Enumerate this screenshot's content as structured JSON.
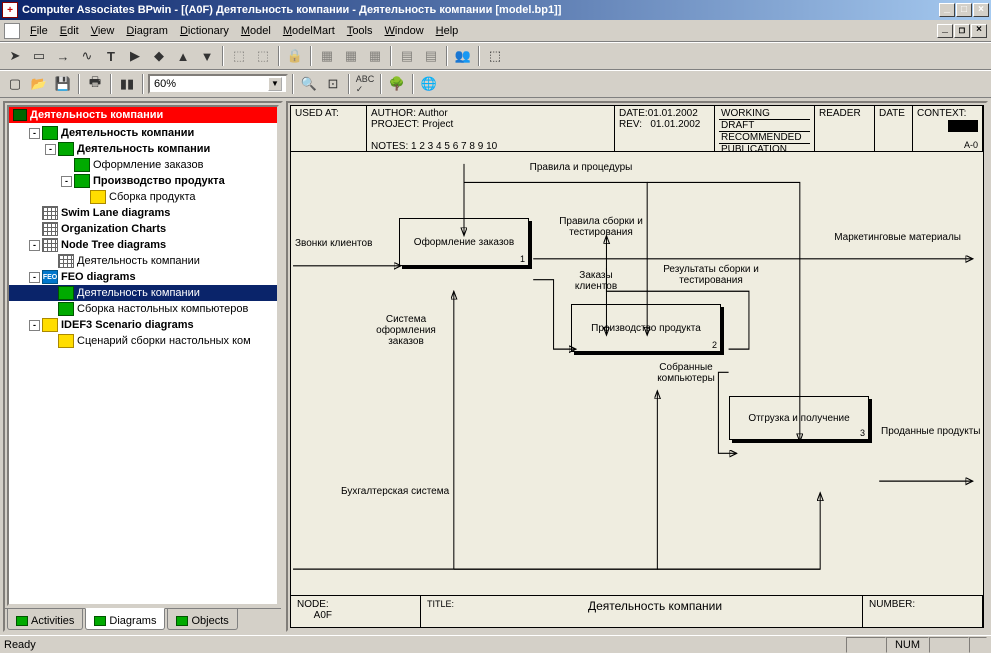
{
  "title": "Computer Associates BPwin - [(A0F) Деятельность компании - Деятельность компании  [model.bp1]]",
  "menu": [
    "File",
    "Edit",
    "View",
    "Diagram",
    "Dictionary",
    "Model",
    "ModelMart",
    "Tools",
    "Window",
    "Help"
  ],
  "zoom": "60%",
  "tree": {
    "root": "Деятельность компании",
    "items": [
      {
        "lvl": 1,
        "exp": "-",
        "icon": "green",
        "bold": true,
        "label": "Деятельность компании"
      },
      {
        "lvl": 2,
        "exp": "-",
        "icon": "green",
        "bold": true,
        "label": "Деятельность компании"
      },
      {
        "lvl": 3,
        "exp": "",
        "icon": "green",
        "bold": false,
        "label": "Оформление заказов"
      },
      {
        "lvl": 3,
        "exp": "-",
        "icon": "green",
        "bold": true,
        "label": "Производство продукта"
      },
      {
        "lvl": 4,
        "exp": "",
        "icon": "yellow",
        "bold": false,
        "label": "Сборка продукта"
      },
      {
        "lvl": 1,
        "exp": "",
        "icon": "grid",
        "bold": true,
        "label": "Swim Lane diagrams"
      },
      {
        "lvl": 1,
        "exp": "",
        "icon": "grid",
        "bold": true,
        "label": "Organization Charts"
      },
      {
        "lvl": 1,
        "exp": "-",
        "icon": "grid",
        "bold": true,
        "label": "Node Tree diagrams"
      },
      {
        "lvl": 2,
        "exp": "",
        "icon": "grid",
        "bold": false,
        "label": "Деятельность компании"
      },
      {
        "lvl": 1,
        "exp": "-",
        "icon": "blue",
        "bold": true,
        "label": "FEO diagrams",
        "iconText": "FEO"
      },
      {
        "lvl": 2,
        "exp": "",
        "icon": "green",
        "bold": false,
        "label": "Деятельность компании",
        "selected": true
      },
      {
        "lvl": 2,
        "exp": "",
        "icon": "green",
        "bold": false,
        "label": "Сборка настольных компьютеров"
      },
      {
        "lvl": 1,
        "exp": "-",
        "icon": "yellow",
        "bold": true,
        "label": "IDEF3 Scenario diagrams"
      },
      {
        "lvl": 2,
        "exp": "",
        "icon": "yellow",
        "bold": false,
        "label": "Сценарий сборки настольных ком"
      }
    ]
  },
  "panel_tabs": [
    {
      "label": "Activities",
      "active": false
    },
    {
      "label": "Diagrams",
      "active": true
    },
    {
      "label": "Objects",
      "active": false
    }
  ],
  "header": {
    "used_at": "USED AT:",
    "author_lbl": "AUTHOR:",
    "author": "Author",
    "project_lbl": "PROJECT:",
    "project": "Project",
    "notes": "NOTES:  1  2  3  4  5  6  7  8  9  10",
    "date_lbl": "DATE:",
    "date": "01.01.2002",
    "rev_lbl": "REV:",
    "rev": "01.01.2002",
    "status": [
      "WORKING",
      "DRAFT",
      "RECOMMENDED",
      "PUBLICATION"
    ],
    "reader": "READER",
    "date2": "DATE",
    "context": "CONTEXT:",
    "context_code": "A-0"
  },
  "diagram": {
    "top_label": "Правила и процедуры",
    "input": "Звонки клиентов",
    "box1": "Оформление заказов",
    "box2": "Производство продукта",
    "box3": "Отгрузка и получение",
    "l_system": "Система оформления заказов",
    "l_rules": "Правила сборки и тестирования",
    "l_orders": "Заказы клиентов",
    "l_results": "Результаты сборки и тестирования",
    "l_collected": "Собранные компьютеры",
    "l_marketing": "Маркетинговые материалы",
    "l_sold": "Проданные продукты",
    "l_account": "Бухгалтерская система"
  },
  "footer": {
    "node_lbl": "NODE:",
    "node": "A0F",
    "title_lbl": "TITLE:",
    "title": "Деятельность компании",
    "number_lbl": "NUMBER:"
  },
  "status": {
    "ready": "Ready",
    "num": "NUM"
  }
}
